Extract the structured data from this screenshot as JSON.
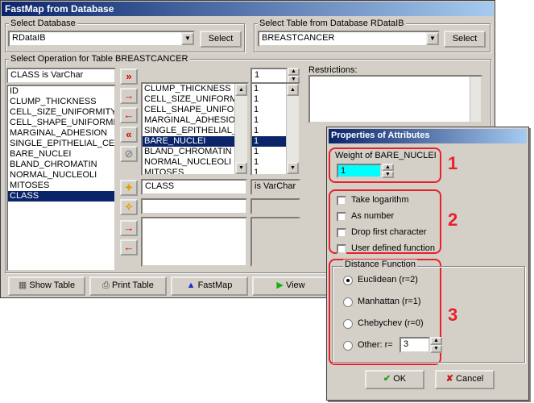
{
  "window": {
    "title": "FastMap from Database"
  },
  "db": {
    "label": "Select Database",
    "value": "RDataIB",
    "select": "Select"
  },
  "table": {
    "label": "Select Table from Database RDataIB",
    "value": "BREASTCANCER",
    "select": "Select"
  },
  "operation": {
    "label": "Select Operation for Table BREASTCANCER"
  },
  "left_list": {
    "header": "CLASS is VarChar",
    "items": [
      "ID",
      "CLUMP_THICKNESS",
      "CELL_SIZE_UNIFORMITY",
      "CELL_SHAPE_UNIFORMIT",
      "MARGINAL_ADHESION",
      "SINGLE_EPITHELIAL_CEL",
      "BARE_NUCLEI",
      "BLAND_CHROMATIN",
      "NORMAL_NUCLEOLI",
      "MITOSES",
      "CLASS"
    ],
    "selected": "CLASS"
  },
  "mid_list": {
    "items": [
      "CLUMP_THICKNESS",
      "CELL_SIZE_UNIFORM",
      "CELL_SHAPE_UNIFOR",
      "MARGINAL_ADHESIO",
      "SINGLE_EPITHELIAL_",
      "BARE_NUCLEI",
      "BLAND_CHROMATIN",
      "NORMAL_NUCLEOLI",
      "MITOSES"
    ],
    "selected": "BARE_NUCLEI"
  },
  "weights": {
    "spin_value": "1",
    "items": [
      "1",
      "1",
      "1",
      "1",
      "1",
      "1",
      "1",
      "1",
      "1"
    ],
    "selected_index": 5
  },
  "restrictions": {
    "label": "Restrictions:"
  },
  "class_row": {
    "field": "CLASS",
    "type": "is VarChar"
  },
  "bottom_buttons": {
    "show_table": "Show Table",
    "print_table": "Print Table",
    "fastmap": "FastMap",
    "view": "View"
  },
  "dialog": {
    "title": "Properties of Attributes",
    "weight_label": "Weight of BARE_NUCLEI",
    "weight_value": "1",
    "options": [
      "Take logarithm",
      "As number",
      "Drop first character",
      "User defined function"
    ],
    "distance_label": "Distance Function",
    "distances": [
      "Euclidean (r=2)",
      "Manhattan (r=1)",
      "Chebychev (r=0)",
      "Other: r="
    ],
    "selected_distance": 0,
    "other_r": "3",
    "ok": "OK",
    "cancel": "Cancel",
    "annotations": [
      "1",
      "2",
      "3"
    ]
  },
  "colors": {
    "accent_red": "#e8202a",
    "title_blue": "#0a246a",
    "cyan": "#00ffff"
  }
}
